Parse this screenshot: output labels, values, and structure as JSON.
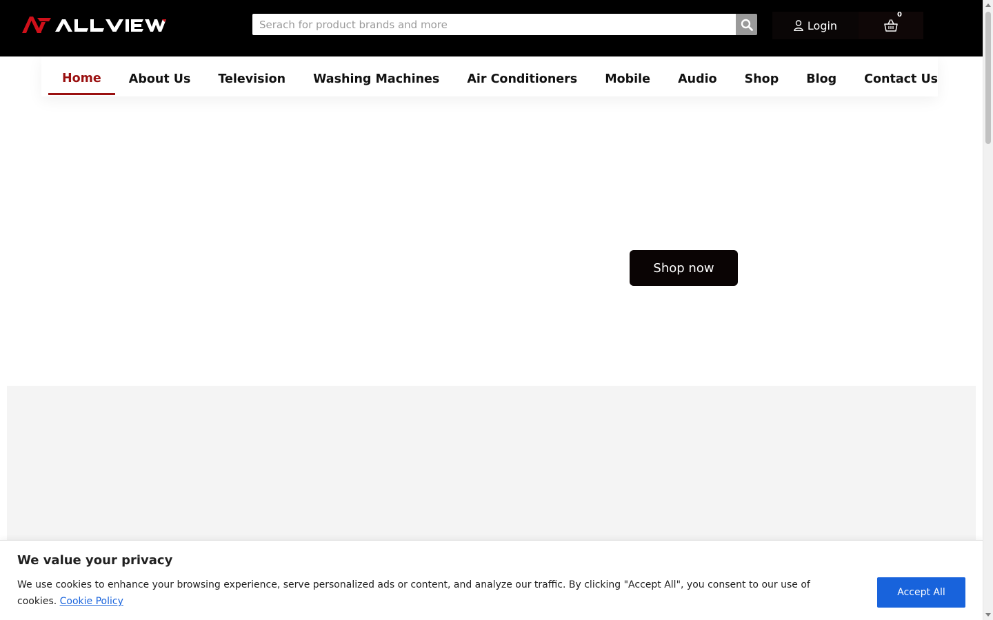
{
  "brand": {
    "name": "ALLVIEW",
    "accent": "#d0101a"
  },
  "header": {
    "search_placeholder": "Serach for product brands and more",
    "search_icon": "search-icon",
    "login_label": "Login",
    "login_icon": "user-icon",
    "cart_icon": "basket-icon",
    "cart_count": "0"
  },
  "nav": {
    "active_color": "#9a1010",
    "items": [
      {
        "label": "Home",
        "active": true
      },
      {
        "label": "About Us"
      },
      {
        "label": "Television"
      },
      {
        "label": "Washing Machines"
      },
      {
        "label": "Air Conditioners"
      },
      {
        "label": "Mobile"
      },
      {
        "label": "Audio"
      },
      {
        "label": "Shop"
      },
      {
        "label": "Blog"
      },
      {
        "label": "Contact Us"
      }
    ]
  },
  "hero": {
    "cta_label": "Shop now"
  },
  "cookie": {
    "title": "We value your privacy",
    "text": "We use cookies to enhance your browsing experience, serve personalized ads or content, and analyze our traffic. By clicking \"Accept All\", you consent to our use of cookies.",
    "link_label": "Cookie Policy",
    "accept_label": "Accept All",
    "accept_color": "#1863dc"
  }
}
